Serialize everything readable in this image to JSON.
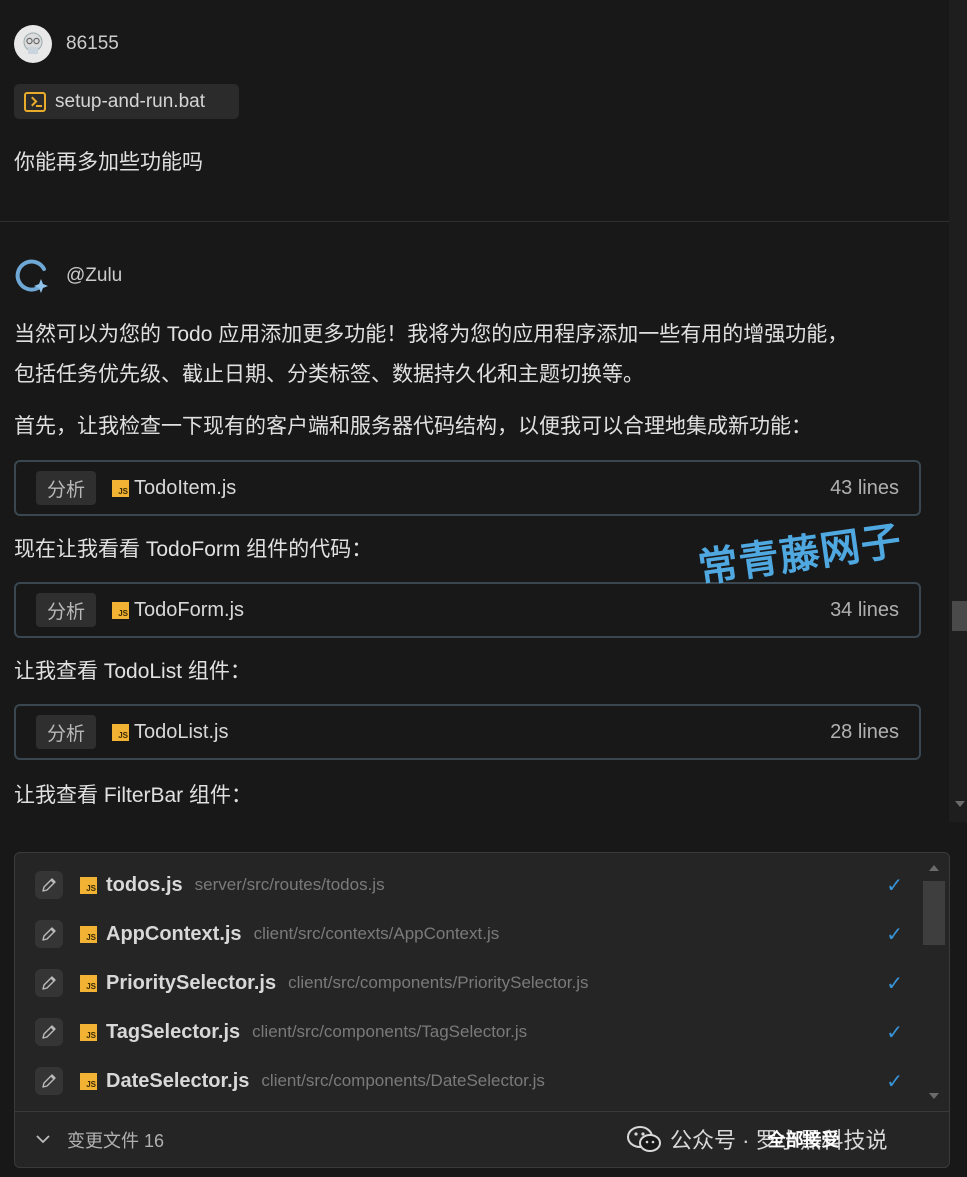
{
  "user_message": {
    "username": "86155",
    "attachment": "setup-and-run.bat",
    "text": "你能再多加些功能吗"
  },
  "assistant": {
    "name": "@Zulu",
    "para1_line1": "当然可以为您的 Todo 应用添加更多功能！我将为您的应用程序添加一些有用的增强功能，",
    "para1_line2": "包括任务优先级、截止日期、分类标签、数据持久化和主题切换等。",
    "para2": "首先，让我检查一下现有的客户端和服务器代码结构，以便我可以合理地集成新功能：",
    "para3": "现在让我看看 TodoForm 组件的代码：",
    "para4": "让我查看 TodoList 组件：",
    "para5": "让我查看 FilterBar 组件：",
    "tools": [
      {
        "tag": "分析",
        "file": "TodoItem.js",
        "lines": "43 lines"
      },
      {
        "tag": "分析",
        "file": "TodoForm.js",
        "lines": "34 lines"
      },
      {
        "tag": "分析",
        "file": "TodoList.js",
        "lines": "28 lines"
      }
    ]
  },
  "watermark": "常青藤网子",
  "changed_files": {
    "items": [
      {
        "name": "todos.js",
        "path": "server/src/routes/todos.js"
      },
      {
        "name": "AppContext.js",
        "path": "client/src/contexts/AppContext.js"
      },
      {
        "name": "PrioritySelector.js",
        "path": "client/src/components/PrioritySelector.js"
      },
      {
        "name": "TagSelector.js",
        "path": "client/src/components/TagSelector.js"
      },
      {
        "name": "DateSelector.js",
        "path": "client/src/components/DateSelector.js"
      }
    ],
    "footer_label": "变更文件 16",
    "overlay_button": "全部接受"
  },
  "wechat_watermark": "公众号 · 罗小黑科技说",
  "colors": {
    "accent": "#3794d8",
    "js_icon": "#f2b233",
    "watermark": "#4fa8e0"
  }
}
